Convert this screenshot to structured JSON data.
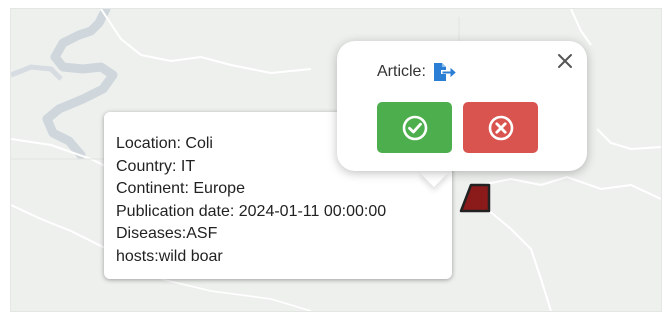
{
  "tooltip": {
    "lines": [
      "Location: Coli",
      "Country: IT",
      "Continent: Europe",
      "Publication date: 2024-01-11 00:00:00",
      "Diseases:ASF",
      "hosts:wild boar"
    ]
  },
  "popup": {
    "article_label": "Article:",
    "article_icon": "file-export-icon",
    "close_icon": "close-icon",
    "accept_icon": "check-circle-icon",
    "reject_icon": "x-circle-icon"
  },
  "colors": {
    "accept": "#4cae4c",
    "reject": "#d9534f",
    "article_icon": "#2a7fd4",
    "marker": "#8b1a1a",
    "map_background": "#eef0ee",
    "river": "#cfd6dc"
  }
}
